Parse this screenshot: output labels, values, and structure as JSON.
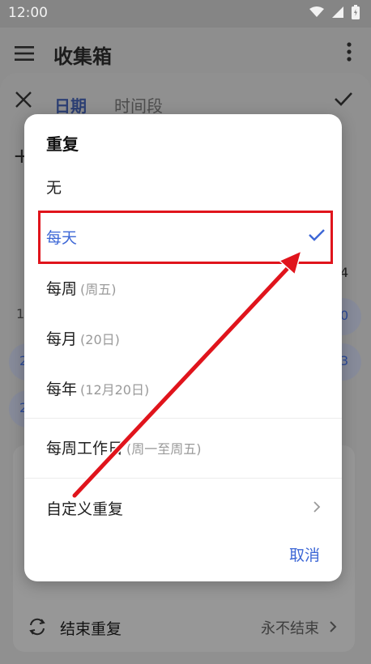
{
  "status_bar": {
    "time": "12:00"
  },
  "app_bar": {
    "title": "收集箱"
  },
  "sheet": {
    "tabs": [
      "日期",
      "时间段"
    ],
    "partial_number_left": "1",
    "partial_blue_1": "2",
    "partial_blue_2": "2",
    "right_partial_1": "4",
    "right_partial_2": "0",
    "right_partial_3": "3",
    "end_repeat": {
      "label": "结束重复",
      "value": "永不结束"
    }
  },
  "dialog": {
    "title": "重复",
    "options": [
      {
        "label": "无",
        "sub": ""
      },
      {
        "label": "每天",
        "sub": "",
        "selected": true
      },
      {
        "label": "每周",
        "sub": "(周五)"
      },
      {
        "label": "每月",
        "sub": "(20日)"
      },
      {
        "label": "每年",
        "sub": "(12月20日)"
      },
      {
        "label": "每周工作日",
        "sub": "(周一至周五)"
      },
      {
        "label": "自定义重复",
        "sub": ""
      }
    ],
    "cancel_label": "取消"
  },
  "colors": {
    "accent": "#3d67d6",
    "annotation_red": "#e0141c",
    "overlay": "#8e8e8e"
  }
}
